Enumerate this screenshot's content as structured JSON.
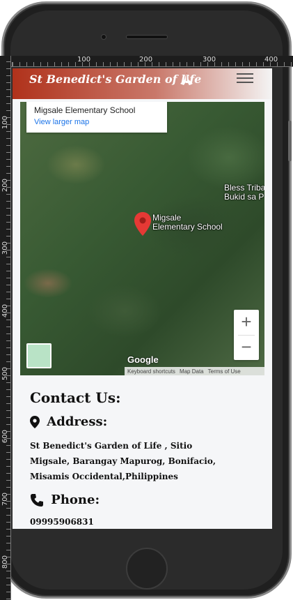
{
  "ruler": {
    "top_marks": [
      "100",
      "200",
      "300",
      "400"
    ],
    "left_marks": [
      "100",
      "200",
      "300",
      "400",
      "500",
      "600",
      "700",
      "800"
    ]
  },
  "navbar": {
    "brand": "St Benedict's Garden of life",
    "brand_icon": "praying-hands-icon",
    "menu_icon": "hamburger-menu-icon"
  },
  "map": {
    "place_name": "Migsale Elementary School",
    "view_larger": "View larger map",
    "pin_label": "Migsale\nElementary School",
    "side_label": "Bless Triba\nBukid sa P",
    "zoom_in": "+",
    "zoom_out": "−",
    "google": "Google",
    "footer": [
      "Keyboard shortcuts",
      "Map Data",
      "Terms of Use"
    ],
    "pin_color": "#e53935"
  },
  "contact": {
    "title": "Contact Us:",
    "address_label": "Address:",
    "address_icon": "map-marker-icon",
    "address": "St Benedict's Garden of Life , Sitio Migsale, Barangay Mapurog, Bonifacio, Misamis Occidental,Philippines",
    "phone_label": "Phone:",
    "phone_icon": "phone-icon",
    "phone": "09995906831"
  }
}
